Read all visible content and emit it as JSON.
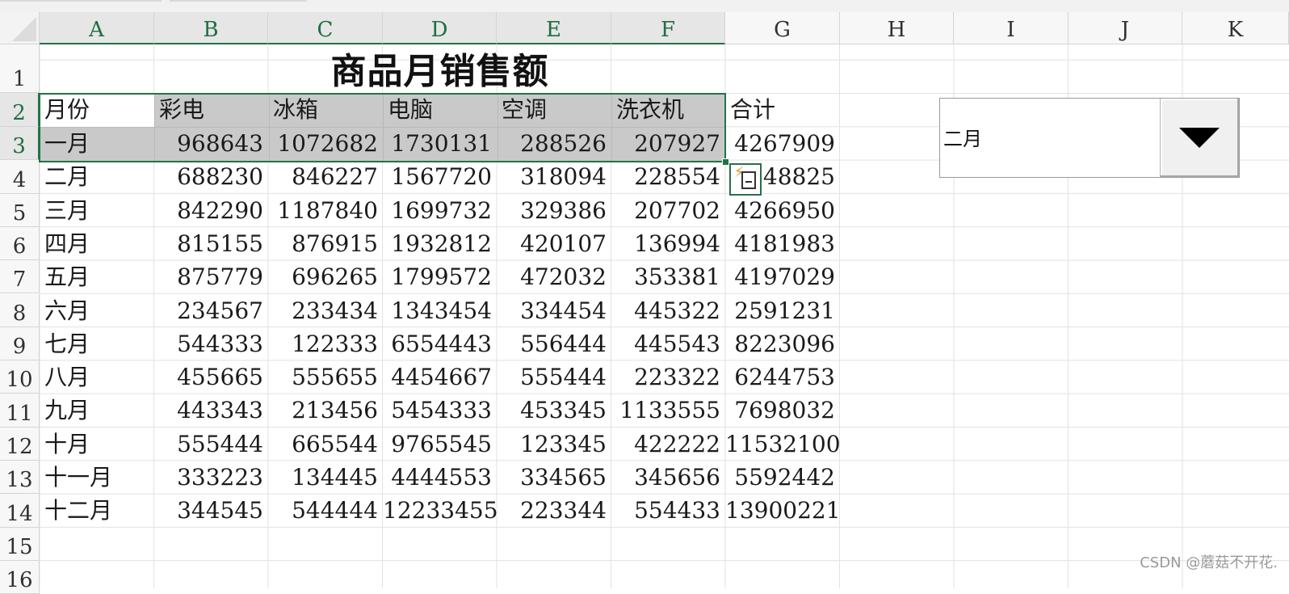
{
  "sheet": {
    "columns": [
      "A",
      "B",
      "C",
      "D",
      "E",
      "F",
      "G",
      "H",
      "I",
      "J",
      "K"
    ],
    "selected_columns": [
      "A",
      "B",
      "C",
      "D",
      "E",
      "F"
    ],
    "rows": [
      "1",
      "2",
      "3",
      "4",
      "5",
      "6",
      "7",
      "8",
      "9",
      "10",
      "11",
      "12",
      "13",
      "14",
      "15",
      "16"
    ],
    "selected_rows": [
      "2",
      "3"
    ],
    "title": "商品月销售额",
    "headers": [
      "月份",
      "彩电",
      "冰箱",
      "电脑",
      "空调",
      "洗衣机",
      "合计"
    ],
    "data_rows": [
      {
        "month": "一月",
        "values": [
          "968643",
          "1072682",
          "1730131",
          "288526",
          "207927",
          "4267909"
        ]
      },
      {
        "month": "二月",
        "values": [
          "688230",
          "846227",
          "1567720",
          "318094",
          "228554",
          "3648825"
        ]
      },
      {
        "month": "三月",
        "values": [
          "842290",
          "1187840",
          "1699732",
          "329386",
          "207702",
          "4266950"
        ]
      },
      {
        "month": "四月",
        "values": [
          "815155",
          "876915",
          "1932812",
          "420107",
          "136994",
          "4181983"
        ]
      },
      {
        "month": "五月",
        "values": [
          "875779",
          "696265",
          "1799572",
          "472032",
          "353381",
          "4197029"
        ]
      },
      {
        "month": "六月",
        "values": [
          "234567",
          "233434",
          "1343454",
          "334454",
          "445322",
          "2591231"
        ]
      },
      {
        "month": "七月",
        "values": [
          "544333",
          "122333",
          "6554443",
          "556444",
          "445543",
          "8223096"
        ]
      },
      {
        "month": "八月",
        "values": [
          "455665",
          "555655",
          "4454667",
          "555444",
          "223322",
          "6244753"
        ]
      },
      {
        "month": "九月",
        "values": [
          "443343",
          "213456",
          "5454333",
          "453345",
          "1133555",
          "7698032"
        ]
      },
      {
        "month": "十月",
        "values": [
          "555444",
          "665544",
          "9765545",
          "123345",
          "422222",
          "11532100"
        ]
      },
      {
        "month": "十一月",
        "values": [
          "333223",
          "134445",
          "4444553",
          "334565",
          "345656",
          "5592442"
        ]
      },
      {
        "month": "十二月",
        "values": [
          "344545",
          "544444",
          "12233455",
          "223344",
          "554433",
          "13900221"
        ]
      }
    ]
  },
  "combo_box": {
    "value": "二月",
    "button_icon": "dropdown-triangle-icon"
  },
  "quick_analysis_icon": "flash-fill-icon",
  "watermark": "CSDN @蘑菇不开花.",
  "colors": {
    "selection_border": "#217346",
    "selection_fill": "#c9c9c9",
    "gridline": "#e2e2e2",
    "header_bg": "#f7f7f7"
  }
}
